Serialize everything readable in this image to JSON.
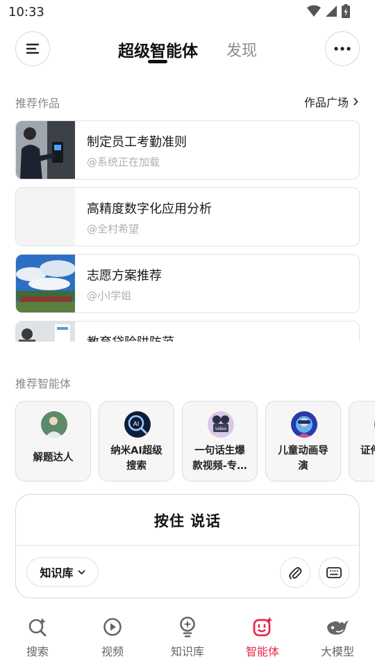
{
  "status_bar": {
    "time": "10:33"
  },
  "header": {
    "tab_active": "超级智能体",
    "tab_discover": "发现"
  },
  "works": {
    "section_label": "推荐作品",
    "more_link": "作品广场",
    "items": [
      {
        "title": "制定员工考勤准则",
        "author": "@系统正在加载"
      },
      {
        "title": "高精度数字化应用分析",
        "author": "@全村希望"
      },
      {
        "title": "志愿方案推荐",
        "author": "@小l学姐"
      },
      {
        "title": "教育贷险阱防范",
        "author": ""
      }
    ]
  },
  "agents": {
    "section_label": "推荐智能体",
    "items": [
      {
        "name_line1": "解题达人",
        "name_line2": ""
      },
      {
        "name_line1": "纳米AI超级",
        "name_line2": "搜索"
      },
      {
        "name_line1": "一句话生爆",
        "name_line2": "款视频-专…"
      },
      {
        "name_line1": "儿童动画导",
        "name_line2": "演"
      },
      {
        "name_line1": "证件",
        "name_line2": ""
      }
    ]
  },
  "voice": {
    "label": "按住 说话",
    "knowledge_chip": "知识库"
  },
  "bottom_nav": {
    "items": [
      {
        "label": "搜索",
        "icon": "search-sparkle-icon"
      },
      {
        "label": "视频",
        "icon": "video-play-icon"
      },
      {
        "label": "知识库",
        "icon": "lightbulb-icon"
      },
      {
        "label": "智能体",
        "icon": "agent-face-icon"
      },
      {
        "label": "大模型",
        "icon": "whale-icon"
      }
    ],
    "active_index": 3
  },
  "colors": {
    "accent": "#e8294a",
    "text": "#1a1a1a",
    "muted": "#8a8a8a",
    "border": "#e2e2e2"
  }
}
